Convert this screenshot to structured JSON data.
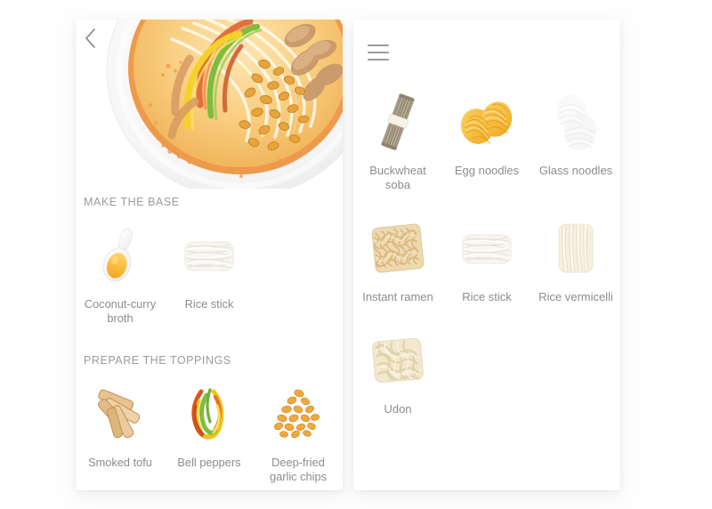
{
  "app": {
    "background_color": "#ffffff",
    "card_color": "#ffffff",
    "label_color": "#8c8c8c",
    "heading_color": "#9b9b9b"
  },
  "left_panel": {
    "back_icon": "chevron-left-icon",
    "hero": {
      "alt": "noodle-soup-bowl-photo",
      "broth_color": "#F6C66A",
      "rim_color": "#ffffff",
      "accent_color": "#E8833C"
    },
    "sections": [
      {
        "title": "MAKE THE BASE",
        "items": [
          {
            "label": "Coconut-curry broth",
            "icon": "spoon-broth-icon",
            "color": "#F7B93C"
          },
          {
            "label": "Rice stick",
            "icon": "rice-stick-icon",
            "color": "#EFEDE6"
          }
        ]
      },
      {
        "title": "PREPARE THE TOPPINGS",
        "items": [
          {
            "label": "Smoked tofu",
            "icon": "smoked-tofu-icon",
            "color": "#E4BE8E"
          },
          {
            "label": "Bell peppers",
            "icon": "bell-peppers-icon",
            "color": "#E8C230"
          },
          {
            "label": "Deep-fried garlic chips",
            "icon": "garlic-chips-icon",
            "color": "#EFA93C"
          }
        ]
      }
    ]
  },
  "right_panel": {
    "menu_icon": "hamburger-menu-icon",
    "items": [
      {
        "label": "Buckwheat soba",
        "icon": "buckwheat-soba-icon",
        "color": "#A79C87"
      },
      {
        "label": "Egg noodles",
        "icon": "egg-noodles-icon",
        "color": "#F4B72B"
      },
      {
        "label": "Glass noodles",
        "icon": "glass-noodles-icon",
        "color": "#F4F4F4"
      },
      {
        "label": "Instant ramen",
        "icon": "instant-ramen-icon",
        "color": "#E8CC9E"
      },
      {
        "label": "Rice stick",
        "icon": "rice-stick-icon",
        "color": "#EFEDE6"
      },
      {
        "label": "Rice vermicelli",
        "icon": "rice-vermicelli-icon",
        "color": "#F3EBDA"
      },
      {
        "label": "Udon",
        "icon": "udon-icon",
        "color": "#F0E6CE"
      }
    ]
  }
}
